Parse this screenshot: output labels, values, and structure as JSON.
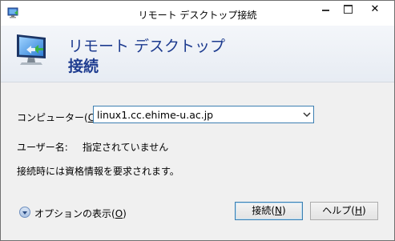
{
  "window": {
    "title": "リモート デスクトップ接続",
    "controls": {
      "minimize": "minimize",
      "maximize": "maximize",
      "close": "✕"
    }
  },
  "header": {
    "line1": "リモート デスクトップ",
    "line2": "接続"
  },
  "form": {
    "computer_label_pre": "コンピューター(",
    "computer_label_key": "C",
    "computer_label_post": "):",
    "computer_value": "linux1.cc.ehime-u.ac.jp",
    "user_label": "ユーザー名:",
    "user_value": "指定されていません",
    "info": "接続時には資格情報を要求されます。"
  },
  "footer": {
    "options_pre": "オプションの表示(",
    "options_key": "O",
    "options_post": ")",
    "connect_pre": "接続(",
    "connect_key": "N",
    "connect_post": ")",
    "help_pre": "ヘルプ(",
    "help_key": "H",
    "help_post": ")"
  },
  "colors": {
    "header_text": "#1d3b8f",
    "focus_border": "#3c7fb1"
  },
  "icons": [
    "remote-desktop-icon",
    "chevron-down-icon",
    "options-expand-icon"
  ]
}
